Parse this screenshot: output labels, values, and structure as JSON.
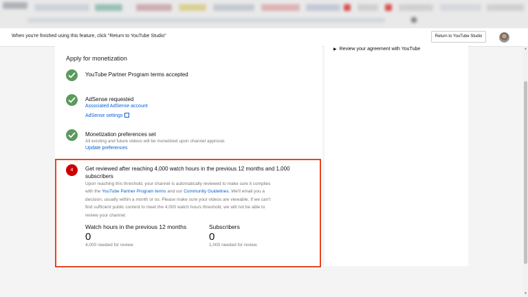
{
  "banner": {
    "notice": "When you're finished using this feature, click \"Return to YouTube Studio\"",
    "return_button": "Return to YouTube Studio"
  },
  "monetization": {
    "title": "Apply for monetization",
    "steps": [
      {
        "title": "YouTube Partner Program terms accepted"
      },
      {
        "title": "AdSense requested",
        "links": [
          "Associated AdSense account",
          "AdSense settings"
        ]
      },
      {
        "title": "Monetization preferences set",
        "description": "All existing and future videos will be monetized upon channel approval.",
        "links": [
          "Update preferences"
        ]
      }
    ],
    "review": {
      "number": "4",
      "title": "Get reviewed after reaching 4,000 watch hours in the previous 12 months and 1,000 subscribers",
      "body_1": "Upon reaching this threshold, your channel is automatically reviewed to make sure it complies with the ",
      "link_1": "YouTube Partner Program terms",
      "body_2": " and our ",
      "link_2": "Community Guidelines",
      "body_3": ". We'll email you a decision, usually within a month or so. Please make sure your videos are viewable. If we can't find sufficient public content to meet the 4,000 watch hours threshold, we will not be able to review your channel.",
      "metrics": [
        {
          "label": "Watch hours in the previous 12 months",
          "value": "0",
          "note": "4,000 needed for review"
        },
        {
          "label": "Subscribers",
          "value": "0",
          "note": "1,000 needed for review"
        }
      ]
    }
  },
  "sidebar": {
    "items": [
      {
        "label": "Review your agreement with YouTube"
      }
    ]
  },
  "colors": {
    "check": "#2e7d32",
    "badge": "#cc0000",
    "link": "#065fd4",
    "highlight_border": "#e8431d"
  }
}
